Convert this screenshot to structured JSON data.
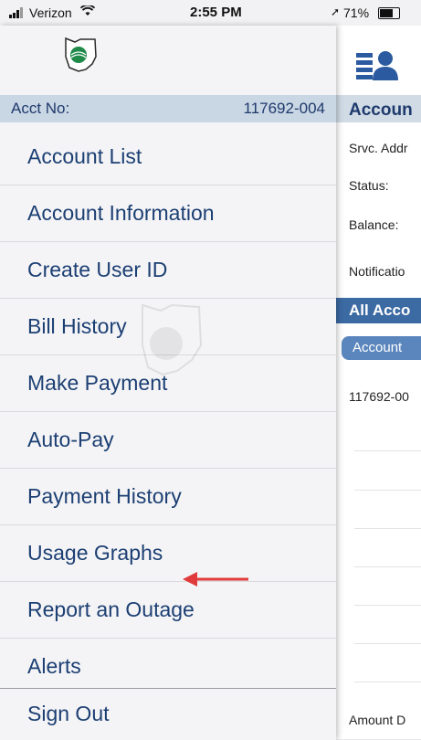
{
  "status_bar": {
    "carrier": "Verizon",
    "time": "2:55 PM",
    "battery": "71%"
  },
  "menu": {
    "account_label": "Acct No:",
    "account_number": "117692-004",
    "items": [
      {
        "label": "Account List"
      },
      {
        "label": "Account Information"
      },
      {
        "label": "Create User ID"
      },
      {
        "label": "Bill History"
      },
      {
        "label": "Make Payment"
      },
      {
        "label": "Auto-Pay"
      },
      {
        "label": "Payment History"
      },
      {
        "label": "Usage Graphs"
      },
      {
        "label": "Report an Outage"
      },
      {
        "label": "Alerts"
      }
    ],
    "sign_out": "Sign Out"
  },
  "right_panel": {
    "header": "Accoun",
    "rows": [
      "Srvc. Addr",
      "Status:",
      "Balance:",
      "Notificatio"
    ],
    "all_accounts": "All Acco",
    "account_tab": "Account",
    "account_row": "117692-00",
    "amount_label": "Amount D"
  },
  "colors": {
    "menu_text": "#1c3f73",
    "account_bar": "#c9d6e4",
    "all_accounts_bar": "#3c6aa3",
    "arrow": "#e03a3a"
  },
  "icons": {
    "logo": "ohio-coop-logo-icon",
    "right_logo": "account-card-icon",
    "arrow": "red-arrow-icon"
  }
}
